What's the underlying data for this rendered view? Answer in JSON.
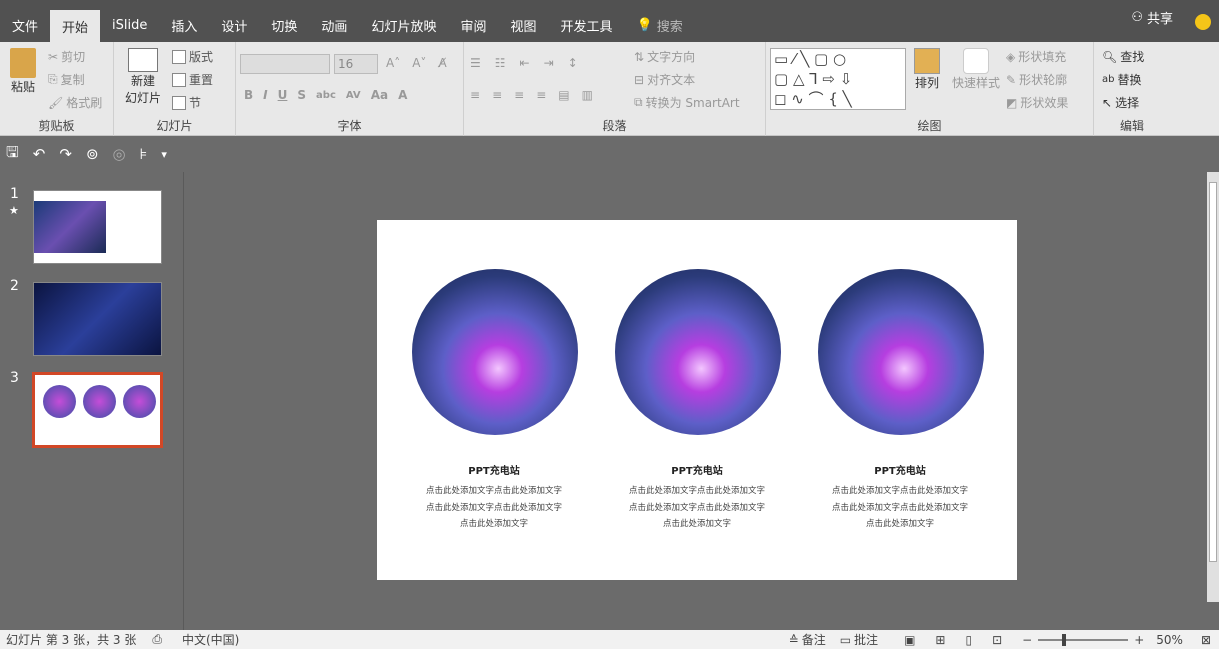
{
  "tabs": [
    "文件",
    "开始",
    "iSlide",
    "插入",
    "设计",
    "切换",
    "动画",
    "幻灯片放映",
    "审阅",
    "视图",
    "开发工具"
  ],
  "search_placeholder": "搜索",
  "share": "共享",
  "clipboard": {
    "paste": "粘贴",
    "cut": "剪切",
    "copy": "复制",
    "format_painter": "格式刷",
    "label": "剪贴板"
  },
  "slides_group": {
    "new_slide_1": "新建",
    "new_slide_2": "幻灯片",
    "layout": "版式",
    "reset": "重置",
    "section": "节",
    "label": "幻灯片"
  },
  "font": {
    "size": "16",
    "label": "字体"
  },
  "paragraph": {
    "text_direction": "文字方向",
    "align_text": "对齐文本",
    "smartart": "转换为 SmartArt",
    "label": "段落"
  },
  "drawing": {
    "arrange": "排列",
    "quick_styles": "快速样式",
    "shape_fill": "形状填充",
    "shape_outline": "形状轮廓",
    "shape_effects": "形状效果",
    "label": "绘图"
  },
  "editing": {
    "find": "查找",
    "replace": "替换",
    "select": "选择",
    "label": "编辑"
  },
  "thumb_numbers": [
    "1",
    "2",
    "3"
  ],
  "slide": {
    "columns": [
      {
        "title": "PPT充电站",
        "body": "点击此处添加文字点击此处添加文字点击此处添加文字点击此处添加文字点击此处添加文字"
      },
      {
        "title": "PPT充电站",
        "body": "点击此处添加文字点击此处添加文字点击此处添加文字点击此处添加文字点击此处添加文字"
      },
      {
        "title": "PPT充电站",
        "body": "点击此处添加文字点击此处添加文字点击此处添加文字点击此处添加文字点击此处添加文字"
      }
    ]
  },
  "status": {
    "slide_info": "幻灯片 第 3 张，共 3 张",
    "language": "中文(中国)",
    "notes": "备注",
    "comments": "批注",
    "zoom": "50%"
  }
}
